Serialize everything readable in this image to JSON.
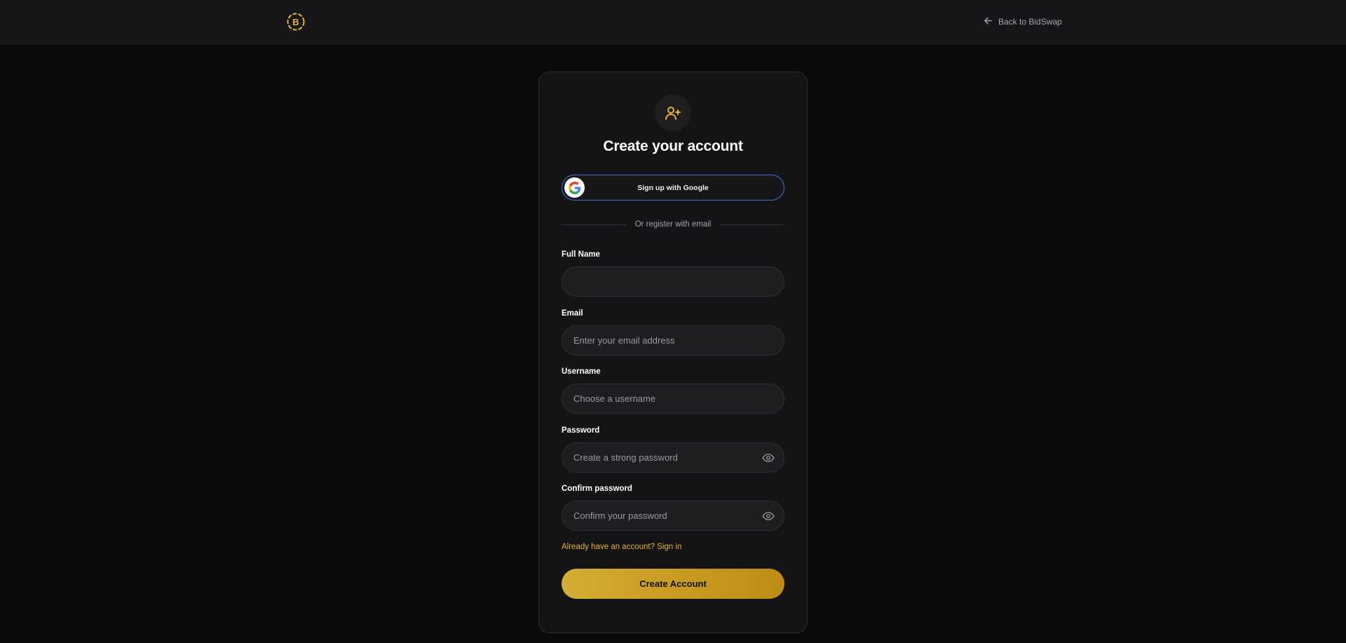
{
  "app": {
    "logo_icon": "bidswap-coin-logo-icon",
    "accent_color": "#e5b32e"
  },
  "header": {
    "back_link": "Back to BidSwap",
    "back_icon": "arrow-left-icon"
  },
  "card": {
    "hero_icon": "user-plus-icon",
    "title": "Create your account",
    "google_button": "Sign up with Google",
    "divider_text": "Or register with email",
    "fields": {
      "full_name": {
        "label": "Full Name",
        "placeholder": "",
        "value": ""
      },
      "email": {
        "label": "Email",
        "placeholder": "Enter your email address",
        "value": ""
      },
      "username": {
        "label": "Username",
        "placeholder": "Choose a username",
        "value": ""
      },
      "password": {
        "label": "Password",
        "placeholder": "Create a strong password",
        "value": "",
        "toggle_icon": "eye-icon"
      },
      "confirm_password": {
        "label": "Confirm password",
        "placeholder": "Confirm your password",
        "value": "",
        "toggle_icon": "eye-icon"
      }
    },
    "signin_link": "Already have an account? Sign in",
    "submit_button": "Create Account"
  }
}
